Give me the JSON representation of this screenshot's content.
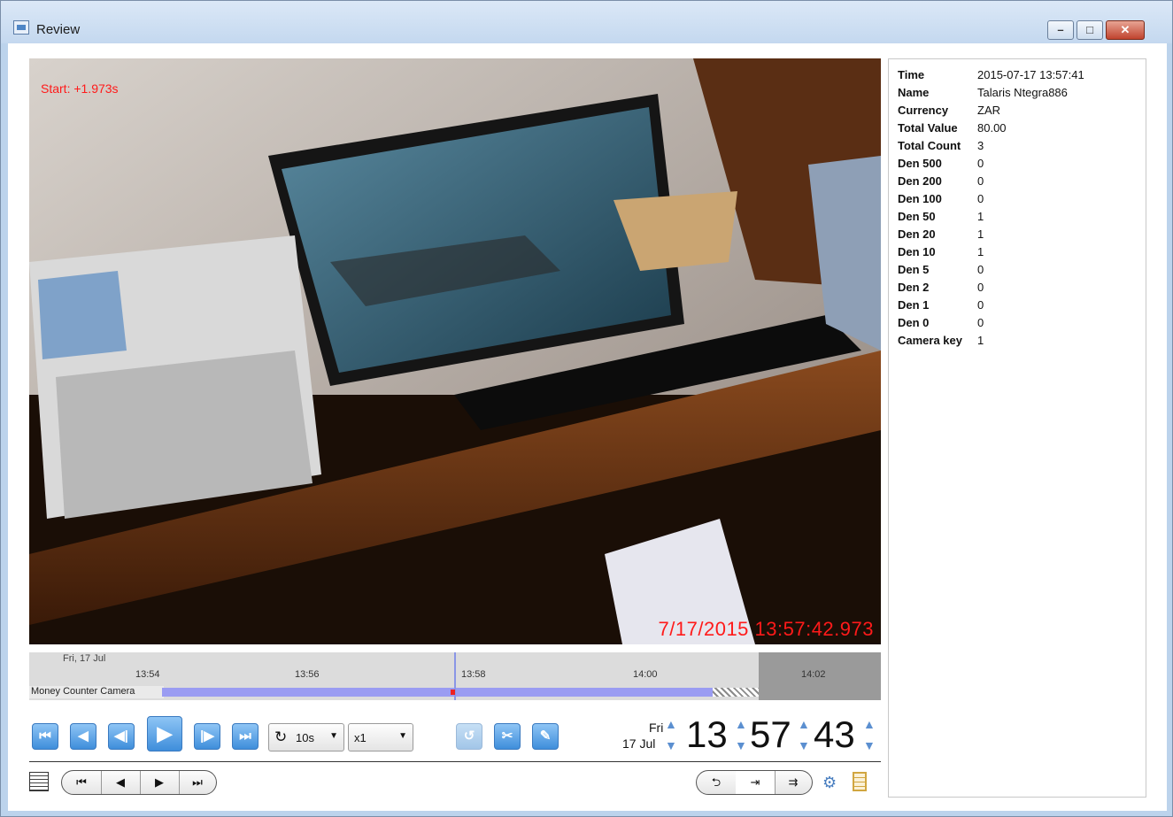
{
  "window": {
    "title": "Review"
  },
  "video": {
    "overlay_start": "Start: +1.973s",
    "overlay_timestamp": "7/17/2015 13:57:42.973"
  },
  "timeline": {
    "date_label": "Fri, 17 Jul",
    "ticks": [
      "13:54",
      "13:56",
      "13:58",
      "14:00",
      "14:02"
    ],
    "track_label": "Money Counter Camera"
  },
  "playback": {
    "loop_interval": "10s",
    "speed": "x1"
  },
  "clock": {
    "day": "Fri",
    "date": "17 Jul",
    "hours": "13",
    "minutes": "57",
    "seconds": "43"
  },
  "details": [
    {
      "key": "Time",
      "value": "2015-07-17 13:57:41"
    },
    {
      "key": "Name",
      "value": "Talaris Ntegra886"
    },
    {
      "key": "Currency",
      "value": "ZAR"
    },
    {
      "key": "Total Value",
      "value": "80.00"
    },
    {
      "key": "Total Count",
      "value": "3"
    },
    {
      "key": "Den 500",
      "value": "0"
    },
    {
      "key": "Den 200",
      "value": "0"
    },
    {
      "key": "Den 100",
      "value": "0"
    },
    {
      "key": "Den 50",
      "value": "1"
    },
    {
      "key": "Den 20",
      "value": "1"
    },
    {
      "key": "Den 10",
      "value": "1"
    },
    {
      "key": "Den 5",
      "value": "0"
    },
    {
      "key": "Den 2",
      "value": "0"
    },
    {
      "key": "Den 1",
      "value": "0"
    },
    {
      "key": "Den 0",
      "value": "0"
    },
    {
      "key": "Camera key",
      "value": "1"
    }
  ]
}
